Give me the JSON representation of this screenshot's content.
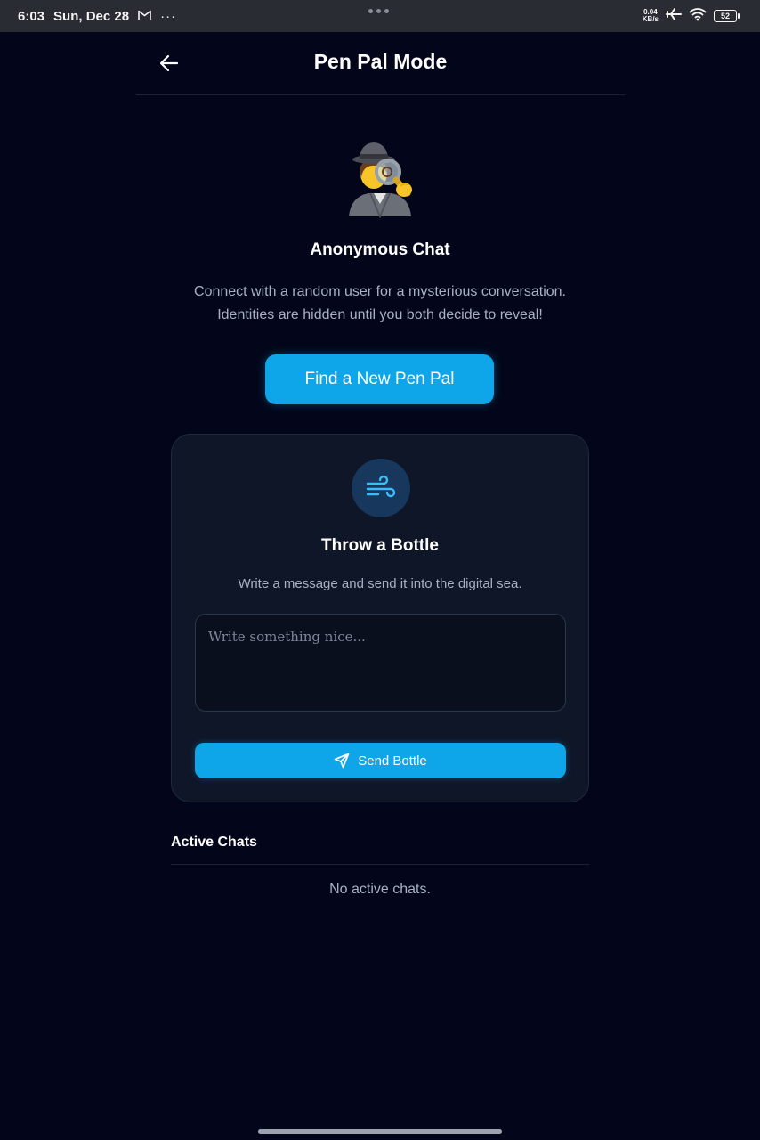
{
  "status_bar": {
    "time": "6:03",
    "date": "Sun, Dec 28",
    "mail_glyph": "M",
    "more": "···",
    "speed_value": "0.04",
    "speed_unit": "KB/s",
    "battery": "52",
    "icons": [
      "gmail-icon",
      "airplane-mode-icon",
      "wifi-icon",
      "battery-icon"
    ]
  },
  "header": {
    "title": "Pen Pal Mode",
    "back_icon": "arrow-left-icon"
  },
  "anonymous": {
    "emoji": "🕵️",
    "emoji_name": "detective-icon",
    "title": "Anonymous Chat",
    "description_line1": "Connect with a random user for a mysterious conversation.",
    "description_line2": "Identities are hidden until you both decide to reveal!",
    "button_label": "Find a New Pen Pal"
  },
  "bottle": {
    "icon": "wind-icon",
    "title": "Throw a Bottle",
    "description": "Write a message and send it into the digital sea.",
    "input_value": "",
    "input_placeholder": "Write something nice...",
    "send_icon": "send-icon",
    "send_label": "Send Bottle"
  },
  "active_chats": {
    "title": "Active Chats",
    "empty_text": "No active chats."
  },
  "colors": {
    "background": "#03061a",
    "accent": "#0ea5e9",
    "card": "#0f1628",
    "icon_circle": "#17375c"
  }
}
